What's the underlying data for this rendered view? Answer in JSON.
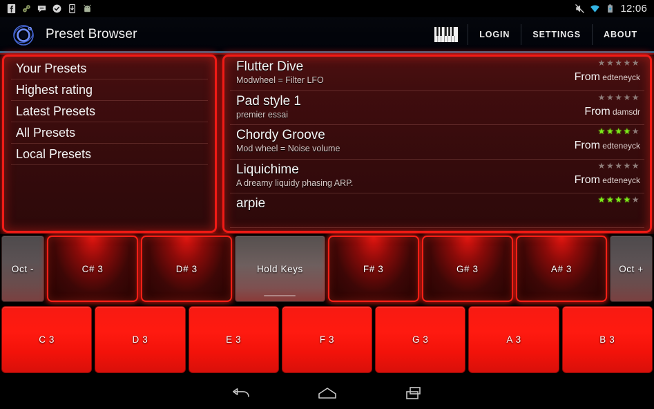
{
  "statusbar": {
    "icons": [
      "facebook-icon",
      "link-icon",
      "chat-bubble-icon",
      "check-circle-icon",
      "download-device-icon",
      "android-head-icon"
    ],
    "right_icons": [
      "mute-icon",
      "wifi-icon",
      "battery-charging-icon"
    ],
    "clock": "12:06"
  },
  "header": {
    "logo": "orbit-logo-icon",
    "title": "Preset Browser",
    "keyboard_icon": "piano-keyboard-icon",
    "nav": [
      {
        "label": "LOGIN",
        "name": "login"
      },
      {
        "label": "SETTINGS",
        "name": "settings"
      },
      {
        "label": "ABOUT",
        "name": "about"
      }
    ],
    "accent_color": "#2b6f91"
  },
  "categories": {
    "items": [
      {
        "label": "Your Presets"
      },
      {
        "label": "Highest rating"
      },
      {
        "label": "Latest Presets"
      },
      {
        "label": "All Presets"
      },
      {
        "label": "Local Presets"
      }
    ]
  },
  "presets": {
    "from_label": "From",
    "items": [
      {
        "name": "Flutter Dive",
        "desc": "Modwheel = Filter LFO",
        "author": "edteneyck",
        "rating": 0
      },
      {
        "name": "Pad style 1",
        "desc": "premier essai",
        "author": "damsdr",
        "rating": 0
      },
      {
        "name": "Chordy Groove",
        "desc": "Mod wheel = Noise volume",
        "author": "edteneyck",
        "rating": 4
      },
      {
        "name": "Liquichime",
        "desc": "A dreamy liquidy phasing ARP.",
        "author": "edteneyck",
        "rating": 0
      },
      {
        "name": "arpie",
        "desc": "",
        "author": "",
        "rating": 4
      }
    ],
    "star_on_color": "#7bec19",
    "star_off_color": "#8d7b78",
    "panel_border_color": "#f01b16"
  },
  "keyboard": {
    "black_row": [
      {
        "label": "Oct -",
        "type": "gray"
      },
      {
        "label": "C# 3",
        "type": "black"
      },
      {
        "label": "D# 3",
        "type": "black"
      },
      {
        "label": "Hold Keys",
        "type": "hold"
      },
      {
        "label": "F# 3",
        "type": "black"
      },
      {
        "label": "G# 3",
        "type": "black"
      },
      {
        "label": "A# 3",
        "type": "black"
      },
      {
        "label": "Oct +",
        "type": "gray"
      }
    ],
    "white_row": [
      {
        "label": "C 3"
      },
      {
        "label": "D 3"
      },
      {
        "label": "E 3"
      },
      {
        "label": "F 3"
      },
      {
        "label": "G 3"
      },
      {
        "label": "A 3"
      },
      {
        "label": "B 3"
      }
    ]
  },
  "navbar": {
    "buttons": [
      {
        "name": "back-button"
      },
      {
        "name": "home-button"
      },
      {
        "name": "recents-button"
      }
    ]
  }
}
